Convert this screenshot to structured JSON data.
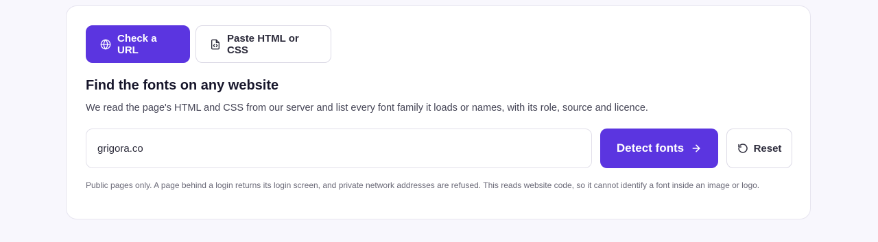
{
  "tabs": [
    {
      "label": "Check a URL",
      "icon": "globe-icon",
      "active": true
    },
    {
      "label": "Paste HTML or CSS",
      "icon": "code-file-icon",
      "active": false
    }
  ],
  "heading": "Find the fonts on any website",
  "description": "We read the page's HTML and CSS from our server and list every font family it loads or names, with its role, source and licence.",
  "url_input": {
    "value": "grigora.co"
  },
  "detect_button": {
    "label": "Detect fonts",
    "icon": "arrow-right-icon"
  },
  "reset_button": {
    "label": "Reset",
    "icon": "reset-icon"
  },
  "note": "Public pages only. A page behind a login returns its login screen, and private network addresses are refused. This reads website code, so it cannot identify a font inside an image or logo.",
  "colors": {
    "accent": "#5b35e0",
    "background": "#f8f7fd",
    "card": "#ffffff"
  }
}
